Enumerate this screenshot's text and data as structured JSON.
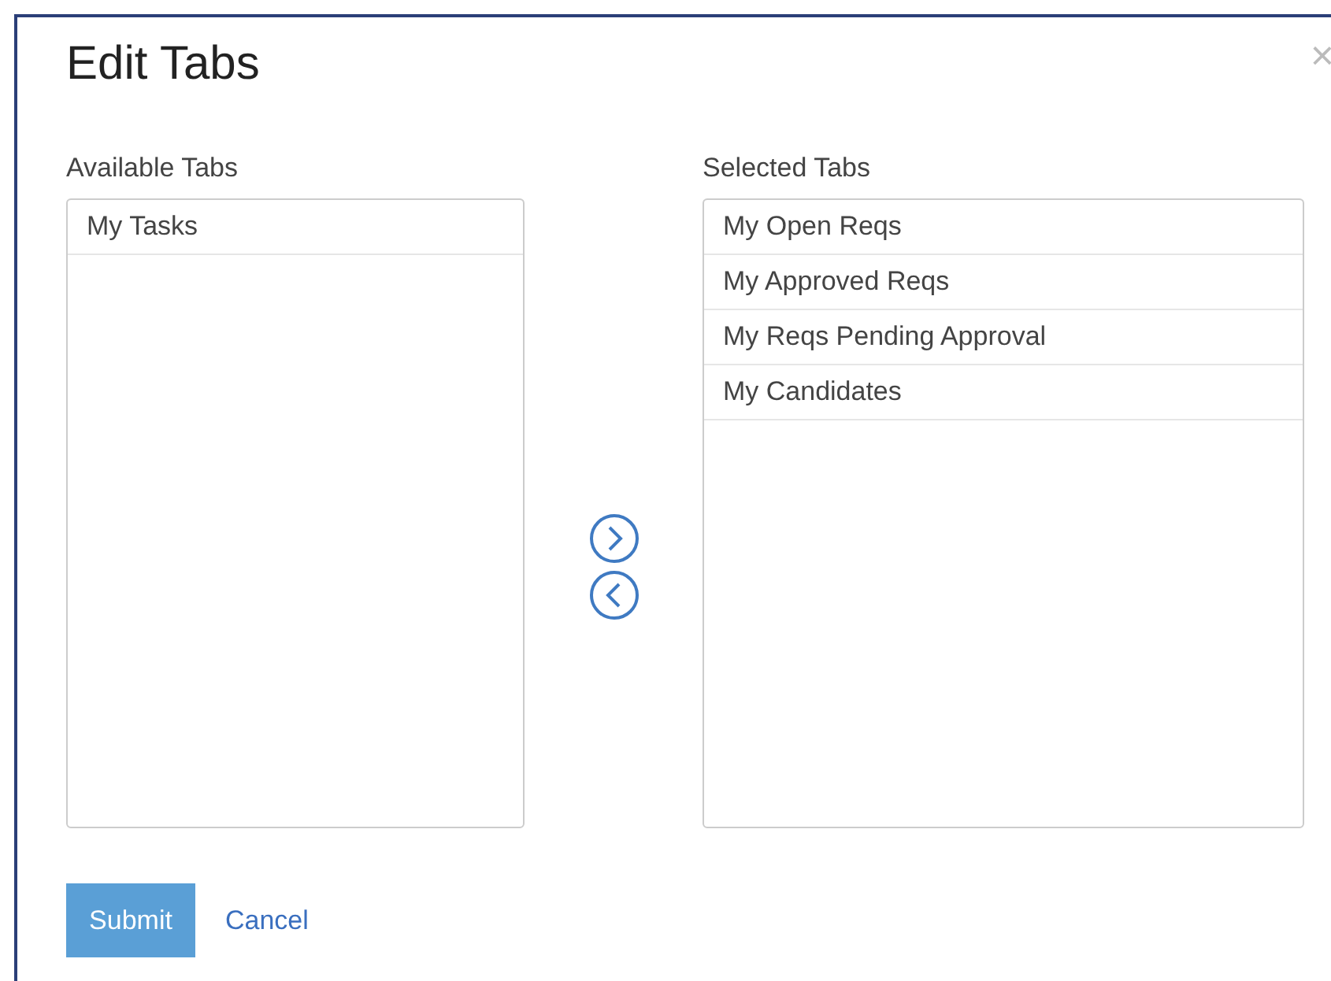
{
  "dialog": {
    "title": "Edit Tabs",
    "close": "×"
  },
  "available": {
    "label": "Available Tabs",
    "items": [
      "My Tasks"
    ]
  },
  "selected": {
    "label": "Selected Tabs",
    "items": [
      "My Open Reqs",
      "My Approved Reqs",
      "My Reqs Pending Approval",
      "My Candidates"
    ]
  },
  "buttons": {
    "submit": "Submit",
    "cancel": "Cancel"
  }
}
